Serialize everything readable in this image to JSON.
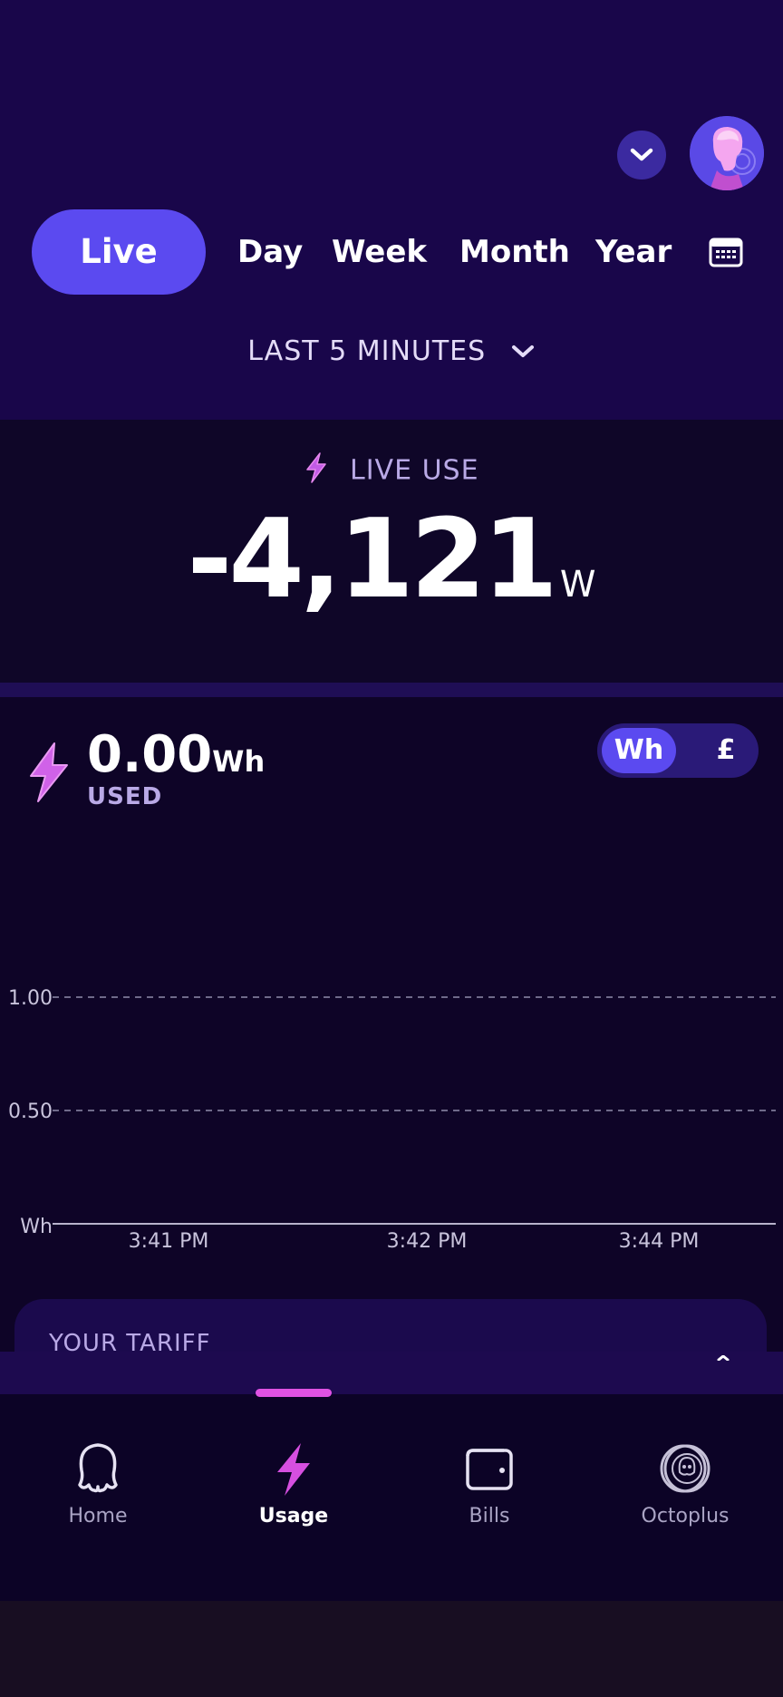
{
  "header": {
    "account_dropdown_icon": "chevron-down-icon",
    "avatar_icon": "user-avatar-icon"
  },
  "period_tabs": [
    {
      "label": "Live",
      "active": true
    },
    {
      "label": "Day",
      "active": false
    },
    {
      "label": "Week",
      "active": false
    },
    {
      "label": "Month",
      "active": false
    },
    {
      "label": "Year",
      "active": false
    }
  ],
  "calendar_icon": "calendar-icon",
  "range": {
    "label": "LAST 5 MINUTES",
    "icon": "chevron-down-icon"
  },
  "live_use": {
    "label": "LIVE USE",
    "value": "-4,121",
    "unit": "W"
  },
  "usage_summary": {
    "value": "0.00",
    "unit": "Wh",
    "label": "USED"
  },
  "unit_toggle": {
    "options": [
      "Wh",
      "£"
    ],
    "selected": "Wh"
  },
  "chart_data": {
    "type": "bar",
    "categories": [
      "3:41 PM",
      "3:42 PM",
      "3:44 PM"
    ],
    "values": [
      0,
      0,
      0
    ],
    "ylabel": "Wh",
    "y_ticks": [
      "1.00",
      "0.50"
    ],
    "ylim": [
      0,
      1.2
    ],
    "grid": true
  },
  "tariff": {
    "title": "YOUR TARIFF"
  },
  "bottom_nav": [
    {
      "label": "Home",
      "icon": "octopus-icon",
      "active": false
    },
    {
      "label": "Usage",
      "icon": "lightning-bolt-icon",
      "active": true
    },
    {
      "label": "Bills",
      "icon": "wallet-icon",
      "active": false
    },
    {
      "label": "Octoplus",
      "icon": "octoplus-coin-icon",
      "active": false
    }
  ],
  "colors": {
    "accent": "#5b4af0",
    "highlight": "#e052e3",
    "header_bg": "#19064a",
    "panel_bg": "#0e0427"
  }
}
